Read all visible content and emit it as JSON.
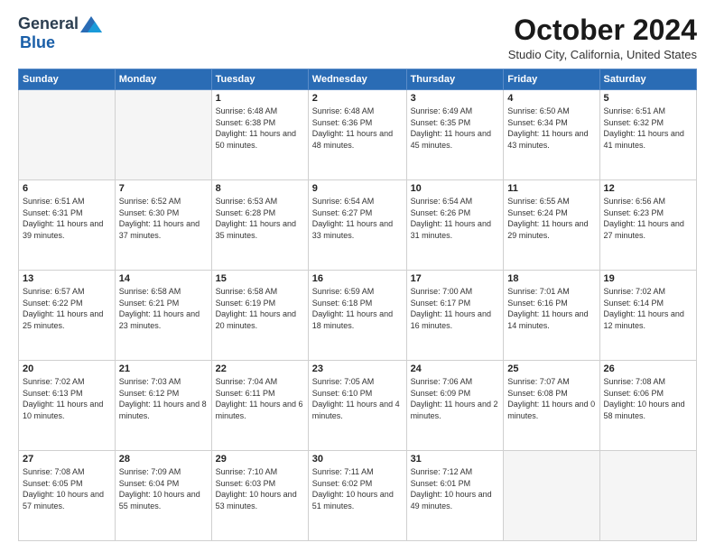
{
  "logo": {
    "general": "General",
    "blue": "Blue"
  },
  "title": "October 2024",
  "location": "Studio City, California, United States",
  "days_header": [
    "Sunday",
    "Monday",
    "Tuesday",
    "Wednesday",
    "Thursday",
    "Friday",
    "Saturday"
  ],
  "weeks": [
    [
      {
        "day": "",
        "text": ""
      },
      {
        "day": "",
        "text": ""
      },
      {
        "day": "1",
        "text": "Sunrise: 6:48 AM\nSunset: 6:38 PM\nDaylight: 11 hours and 50 minutes."
      },
      {
        "day": "2",
        "text": "Sunrise: 6:48 AM\nSunset: 6:36 PM\nDaylight: 11 hours and 48 minutes."
      },
      {
        "day": "3",
        "text": "Sunrise: 6:49 AM\nSunset: 6:35 PM\nDaylight: 11 hours and 45 minutes."
      },
      {
        "day": "4",
        "text": "Sunrise: 6:50 AM\nSunset: 6:34 PM\nDaylight: 11 hours and 43 minutes."
      },
      {
        "day": "5",
        "text": "Sunrise: 6:51 AM\nSunset: 6:32 PM\nDaylight: 11 hours and 41 minutes."
      }
    ],
    [
      {
        "day": "6",
        "text": "Sunrise: 6:51 AM\nSunset: 6:31 PM\nDaylight: 11 hours and 39 minutes."
      },
      {
        "day": "7",
        "text": "Sunrise: 6:52 AM\nSunset: 6:30 PM\nDaylight: 11 hours and 37 minutes."
      },
      {
        "day": "8",
        "text": "Sunrise: 6:53 AM\nSunset: 6:28 PM\nDaylight: 11 hours and 35 minutes."
      },
      {
        "day": "9",
        "text": "Sunrise: 6:54 AM\nSunset: 6:27 PM\nDaylight: 11 hours and 33 minutes."
      },
      {
        "day": "10",
        "text": "Sunrise: 6:54 AM\nSunset: 6:26 PM\nDaylight: 11 hours and 31 minutes."
      },
      {
        "day": "11",
        "text": "Sunrise: 6:55 AM\nSunset: 6:24 PM\nDaylight: 11 hours and 29 minutes."
      },
      {
        "day": "12",
        "text": "Sunrise: 6:56 AM\nSunset: 6:23 PM\nDaylight: 11 hours and 27 minutes."
      }
    ],
    [
      {
        "day": "13",
        "text": "Sunrise: 6:57 AM\nSunset: 6:22 PM\nDaylight: 11 hours and 25 minutes."
      },
      {
        "day": "14",
        "text": "Sunrise: 6:58 AM\nSunset: 6:21 PM\nDaylight: 11 hours and 23 minutes."
      },
      {
        "day": "15",
        "text": "Sunrise: 6:58 AM\nSunset: 6:19 PM\nDaylight: 11 hours and 20 minutes."
      },
      {
        "day": "16",
        "text": "Sunrise: 6:59 AM\nSunset: 6:18 PM\nDaylight: 11 hours and 18 minutes."
      },
      {
        "day": "17",
        "text": "Sunrise: 7:00 AM\nSunset: 6:17 PM\nDaylight: 11 hours and 16 minutes."
      },
      {
        "day": "18",
        "text": "Sunrise: 7:01 AM\nSunset: 6:16 PM\nDaylight: 11 hours and 14 minutes."
      },
      {
        "day": "19",
        "text": "Sunrise: 7:02 AM\nSunset: 6:14 PM\nDaylight: 11 hours and 12 minutes."
      }
    ],
    [
      {
        "day": "20",
        "text": "Sunrise: 7:02 AM\nSunset: 6:13 PM\nDaylight: 11 hours and 10 minutes."
      },
      {
        "day": "21",
        "text": "Sunrise: 7:03 AM\nSunset: 6:12 PM\nDaylight: 11 hours and 8 minutes."
      },
      {
        "day": "22",
        "text": "Sunrise: 7:04 AM\nSunset: 6:11 PM\nDaylight: 11 hours and 6 minutes."
      },
      {
        "day": "23",
        "text": "Sunrise: 7:05 AM\nSunset: 6:10 PM\nDaylight: 11 hours and 4 minutes."
      },
      {
        "day": "24",
        "text": "Sunrise: 7:06 AM\nSunset: 6:09 PM\nDaylight: 11 hours and 2 minutes."
      },
      {
        "day": "25",
        "text": "Sunrise: 7:07 AM\nSunset: 6:08 PM\nDaylight: 11 hours and 0 minutes."
      },
      {
        "day": "26",
        "text": "Sunrise: 7:08 AM\nSunset: 6:06 PM\nDaylight: 10 hours and 58 minutes."
      }
    ],
    [
      {
        "day": "27",
        "text": "Sunrise: 7:08 AM\nSunset: 6:05 PM\nDaylight: 10 hours and 57 minutes."
      },
      {
        "day": "28",
        "text": "Sunrise: 7:09 AM\nSunset: 6:04 PM\nDaylight: 10 hours and 55 minutes."
      },
      {
        "day": "29",
        "text": "Sunrise: 7:10 AM\nSunset: 6:03 PM\nDaylight: 10 hours and 53 minutes."
      },
      {
        "day": "30",
        "text": "Sunrise: 7:11 AM\nSunset: 6:02 PM\nDaylight: 10 hours and 51 minutes."
      },
      {
        "day": "31",
        "text": "Sunrise: 7:12 AM\nSunset: 6:01 PM\nDaylight: 10 hours and 49 minutes."
      },
      {
        "day": "",
        "text": ""
      },
      {
        "day": "",
        "text": ""
      }
    ]
  ]
}
